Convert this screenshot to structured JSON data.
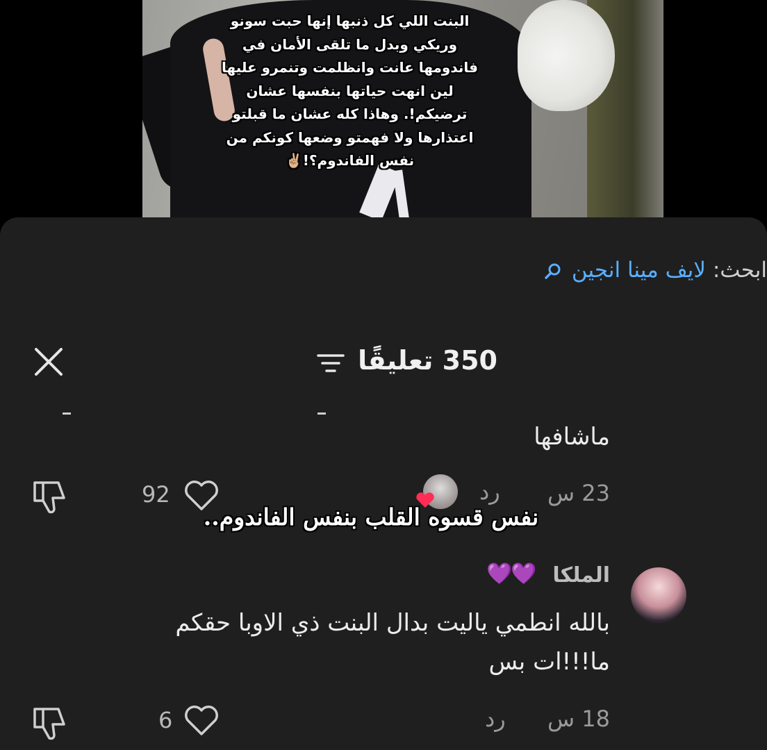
{
  "video": {
    "caption_lines": [
      "البنت اللي كل ذنبها إنها حبت سونو",
      "وريكي وبدل ما تلقى الأمان في",
      "فاندومها عانت وانظلمت وتنمرو عليها",
      "لين انهت حياتها بنفسها عشان",
      "ترضيكم!. وهاذا كله عشان ما قبلتو",
      "اعتذارها ولا فهمتو وضعها كونكم من",
      "نفس الفاندوم؟!✌🏼"
    ]
  },
  "search": {
    "prefix": "ابحث: ",
    "term": "لايف مينا انجين",
    "icon": "search-icon",
    "accent": "#5aaeff"
  },
  "header": {
    "count_label": "350 تعليقًا",
    "filter_icon": "filter-icon",
    "close_icon": "close-icon"
  },
  "comments": [
    {
      "text": "ماشافها",
      "time": "23 س",
      "reply_label": "رد",
      "likes": "92"
    },
    {
      "author": "الملكا",
      "author_hearts": "💜💜",
      "text_lines": [
        "بالله انطمي ياليت بدال البنت ذي الاوبا حقكم",
        "ما!!!ات بس"
      ],
      "time": "18 س",
      "reply_label": "رد",
      "likes": "6"
    }
  ],
  "overlay": {
    "text": "نفس قسوه القلب بنفس الفاندوم.."
  }
}
